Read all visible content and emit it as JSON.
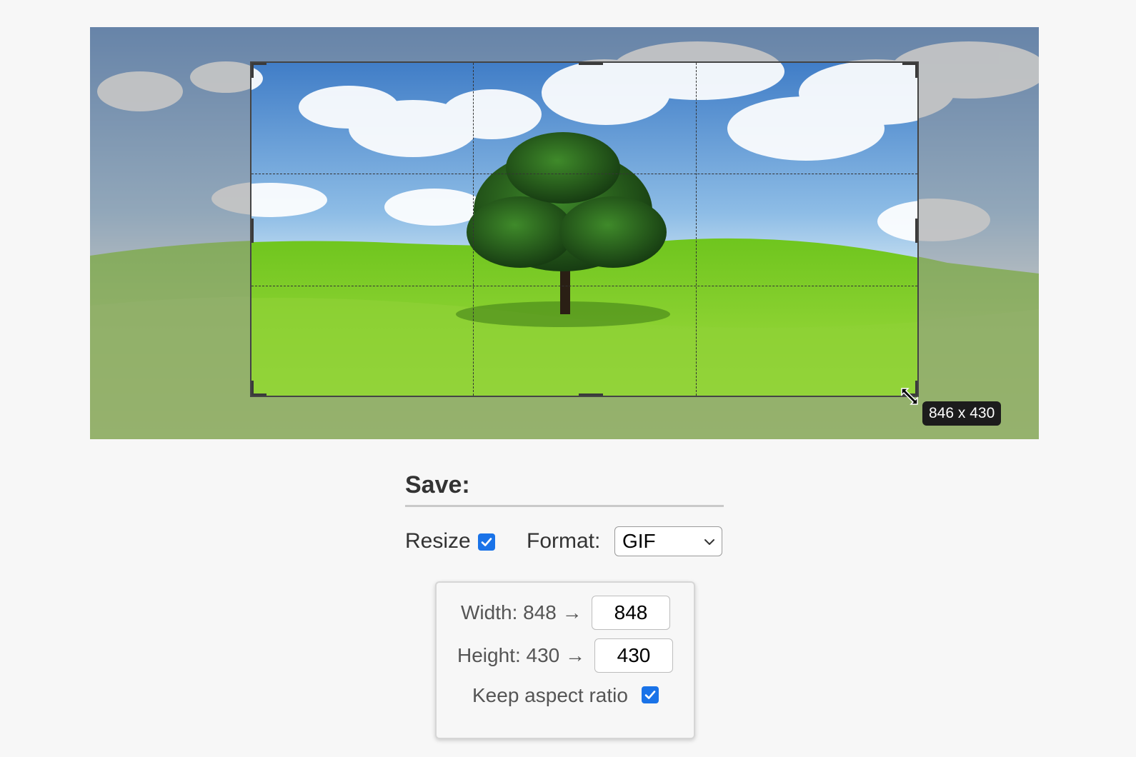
{
  "crop": {
    "size_tooltip": "846 x 430"
  },
  "save_panel": {
    "heading": "Save:",
    "resize_label": "Resize",
    "resize_checked": true,
    "format_label": "Format:",
    "format_value": "GIF",
    "width_label": "Width: 848 →",
    "width_value": "848",
    "height_label": "Height: 430 →",
    "height_value": "430",
    "keep_aspect_label": "Keep aspect ratio",
    "keep_aspect_checked": true
  },
  "colors": {
    "accent": "#1a73e8",
    "tooltip_bg": "#1c1c1c",
    "page_bg": "#f7f7f7"
  },
  "icons": [
    "resize-diagonal-icon",
    "chevron-down-icon",
    "checkmark-icon"
  ]
}
